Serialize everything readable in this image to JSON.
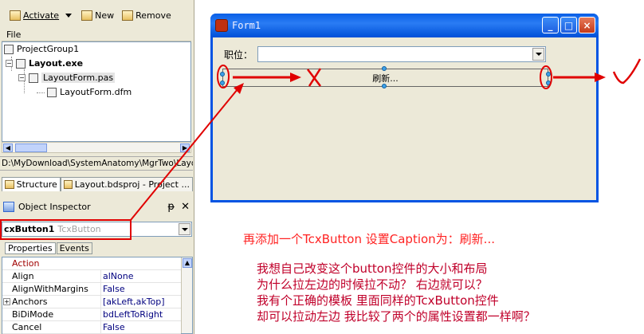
{
  "toolbar": {
    "activate_label": "Activate",
    "new_label": "New",
    "remove_label": "Remove"
  },
  "project_manager": {
    "header": "File",
    "nodes": [
      {
        "label": "ProjectGroup1"
      },
      {
        "label": "Layout.exe"
      },
      {
        "label": "LayoutForm.pas"
      },
      {
        "label": "LayoutForm.dfm"
      }
    ]
  },
  "path_bar": "D:\\MyDownload\\SystemAnatomy\\MgrTwo\\Layout\\",
  "panel_tabs": {
    "structure": "Structure",
    "project": "Layout.bdsproj - Project ..."
  },
  "object_inspector": {
    "title": "Object Inspector",
    "pin_glyph": "ᵽ",
    "close_glyph": "✕",
    "selected_name": "cxButton1",
    "selected_type": "TcxButton",
    "tabs": [
      "Properties",
      "Events"
    ],
    "properties": [
      {
        "name": "Action",
        "value": ""
      },
      {
        "name": "Align",
        "value": "alNone"
      },
      {
        "name": "AlignWithMargins",
        "value": "False"
      },
      {
        "name": "Anchors",
        "value": "[akLeft,akTop]"
      },
      {
        "name": "BiDiMode",
        "value": "bdLeftToRight"
      },
      {
        "name": "Cancel",
        "value": "False"
      }
    ]
  },
  "form": {
    "caption": "Form1",
    "buttons": {
      "minimize": "_",
      "maximize": "□",
      "close": "×"
    },
    "field_label": "职位：",
    "button_caption": "刷新..."
  },
  "annotations": {
    "line1": "再添加一个TcxButton 设置Caption为：刷新...",
    "line2": "我想自己改变这个button控件的大小和布局",
    "line3": "为什么拉左边的时候拉不动？  右边就可以？",
    "line4": "我有个正确的模板 里面同样的TcxButton控件",
    "line5": "却可以拉动左边 我比较了两个的属性设置都一样啊？",
    "red_color": "#ff0000"
  }
}
